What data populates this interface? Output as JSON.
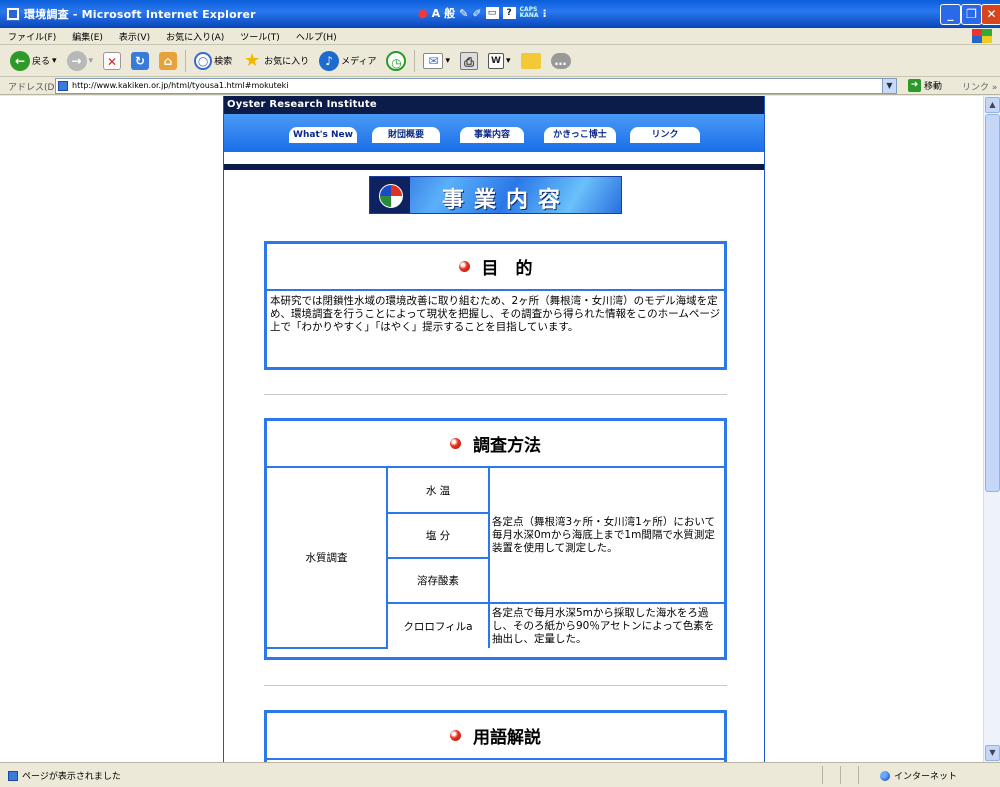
{
  "window": {
    "title": "環境調査 - Microsoft Internet Explorer",
    "ime_text": "般",
    "ime_mode": "A",
    "caps_text": "CAPS",
    "kana_text": "KANA",
    "minimize": "_",
    "maximize": "❐",
    "close": "✕"
  },
  "menu": [
    "ファイル(F)",
    "編集(E)",
    "表示(V)",
    "お気に入り(A)",
    "ツール(T)",
    "ヘルプ(H)"
  ],
  "toolbar": {
    "back_label": "戻る",
    "search_label": "検索",
    "favorites_label": "お気に入り",
    "media_label": "メディア"
  },
  "address": {
    "label": "アドレス(D)",
    "url": "http://www.kakiken.or.jp/html/tyousa1.html#mokuteki",
    "go_label": "移動",
    "links_label": "リンク"
  },
  "site": {
    "header_title": "Oyster Research Institute",
    "nav": [
      "What's New",
      "財団概要",
      "事業内容",
      "かきっこ博士",
      "リンク"
    ],
    "banner_text": "事業内容"
  },
  "sections": {
    "purpose": {
      "title": "目　的",
      "body": "本研究では閉鎖性水域の環境改善に取り組むため、2ヶ所（舞根湾・女川湾）のモデル海域を定め、環境調査を行うことによって現状を把握し、その調査から得られた情報をこのホームページ上で「わかりやすく」「はやく」提示することを目指しています。"
    },
    "method": {
      "title": "調査方法",
      "category": "水質調査",
      "params": [
        "水 温",
        "塩 分",
        "溶存酸素",
        "クロロフィルa"
      ],
      "desc1": "各定点（舞根湾3ヶ所・女川湾1ヶ所）において毎月水深0mから海底上まで1m間隔で水質測定装置を使用して測定した。",
      "desc2": "各定点で毎月水深5mから採取した海水をろ過し、そのろ紙から90％アセトンによって色素を抽出し、定量した。"
    },
    "glossary": {
      "title": "用語解説"
    }
  },
  "status": {
    "message": "ページが表示されました",
    "zone": "インターネット"
  }
}
